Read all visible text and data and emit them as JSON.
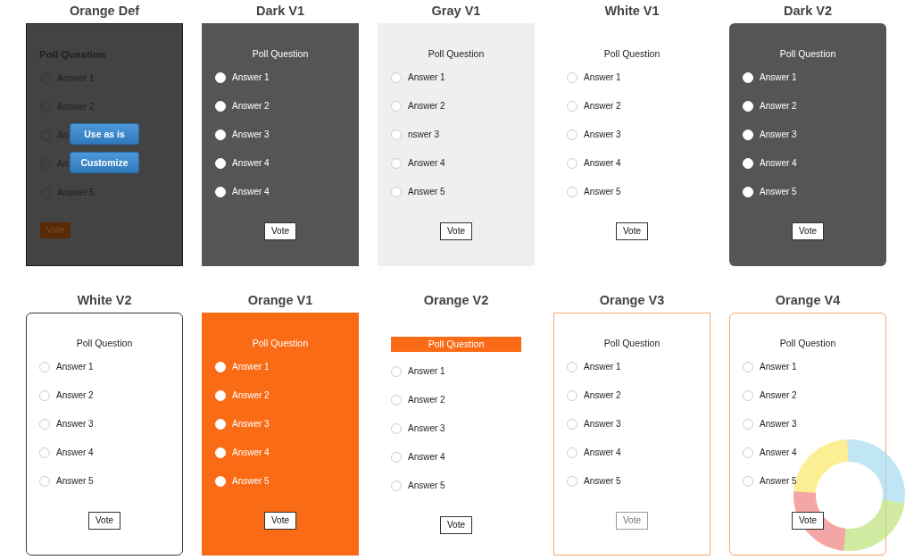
{
  "themes": [
    {
      "title": "Orange Def",
      "kind": "default",
      "hovered": true,
      "hover_actions": [
        "Use as is",
        "Customize"
      ],
      "poll": {
        "question": "Poll Question",
        "answers": [
          {
            "label": "Answer 1",
            "selected": false
          },
          {
            "label": "Answer 2",
            "selected": false
          },
          {
            "label": "An",
            "selected": false
          },
          {
            "label": "An",
            "selected": false
          },
          {
            "label": "Answer 5",
            "selected": false
          }
        ],
        "vote_button": "Vote"
      }
    },
    {
      "title": "Dark V1",
      "kind": "dark",
      "poll": {
        "question": "Poll Question",
        "answers": [
          {
            "label": "Answer 1",
            "selected": false
          },
          {
            "label": "Answer 2",
            "selected": false
          },
          {
            "label": "Answer 3",
            "selected": false
          },
          {
            "label": "Answer 4",
            "selected": false
          },
          {
            "label": "Answer 4",
            "selected": false
          }
        ],
        "vote_button": "Vote"
      }
    },
    {
      "title": "Gray V1",
      "kind": "gray",
      "poll": {
        "question": "Poll Question",
        "answers": [
          {
            "label": "Answer 1",
            "selected": false
          },
          {
            "label": "Answer 2",
            "selected": false
          },
          {
            "label": "nswer 3",
            "selected": false
          },
          {
            "label": "Answer 4",
            "selected": false
          },
          {
            "label": "Answer 5",
            "selected": false
          }
        ],
        "vote_button": "Vote"
      }
    },
    {
      "title": "White V1",
      "kind": "white",
      "poll": {
        "question": "Poll Question",
        "answers": [
          {
            "label": "Answer 1",
            "selected": false
          },
          {
            "label": "Answer 2",
            "selected": false
          },
          {
            "label": "Answer 3",
            "selected": false
          },
          {
            "label": "Answer 4",
            "selected": false
          },
          {
            "label": "Answer 5",
            "selected": false
          }
        ],
        "vote_button": "Vote"
      }
    },
    {
      "title": "Dark V2",
      "kind": "dark-rounded",
      "poll": {
        "question": "Poll Question",
        "answers": [
          {
            "label": "Answer 1",
            "selected": false
          },
          {
            "label": "Answer 2",
            "selected": false
          },
          {
            "label": "Answer 3",
            "selected": false
          },
          {
            "label": "Answer 4",
            "selected": false
          },
          {
            "label": "Answer 5",
            "selected": false
          }
        ],
        "vote_button": "Vote"
      }
    },
    {
      "title": "White V2",
      "kind": "bordered-rounded",
      "poll": {
        "question": "Poll Question",
        "answers": [
          {
            "label": "Answer 1",
            "selected": false
          },
          {
            "label": "Answer 2",
            "selected": false
          },
          {
            "label": "Answer 3",
            "selected": false
          },
          {
            "label": "Answer 4",
            "selected": false
          },
          {
            "label": "Answer 5",
            "selected": false
          }
        ],
        "vote_button": "Vote"
      }
    },
    {
      "title": "Orange V1",
      "kind": "orange",
      "poll": {
        "question": "Poll Question",
        "answers": [
          {
            "label": "Answer 1",
            "selected": false
          },
          {
            "label": "Answer 2",
            "selected": false
          },
          {
            "label": "Answer 3",
            "selected": false
          },
          {
            "label": "Answer 4",
            "selected": false
          },
          {
            "label": "Answer 5",
            "selected": false
          }
        ],
        "vote_button": "Vote"
      }
    },
    {
      "title": "Orange V2",
      "kind": "orange-banner",
      "poll": {
        "question": "Poll Question",
        "answers": [
          {
            "label": "Answer 1",
            "selected": false
          },
          {
            "label": "Answer 2",
            "selected": false
          },
          {
            "label": "Answer 3",
            "selected": false
          },
          {
            "label": "Answer 4",
            "selected": false
          },
          {
            "label": "Answer 5",
            "selected": false
          }
        ],
        "vote_button": "Vote"
      }
    },
    {
      "title": "Orange V3",
      "kind": "orange-outline",
      "poll": {
        "question": "Poll Question",
        "answers": [
          {
            "label": "Answer 1",
            "selected": false
          },
          {
            "label": "Answer 2",
            "selected": false
          },
          {
            "label": "Answer 3",
            "selected": false
          },
          {
            "label": "Answer 4",
            "selected": false
          },
          {
            "label": "Answer 5",
            "selected": false
          }
        ],
        "vote_button": "Vote"
      }
    },
    {
      "title": "Orange V4",
      "kind": "orange-outline-rounded",
      "poll": {
        "question": "Poll Question",
        "answers": [
          {
            "label": "Answer 1",
            "selected": false
          },
          {
            "label": "Answer 2",
            "selected": false
          },
          {
            "label": "Answer 3",
            "selected": false
          },
          {
            "label": "Answer 4",
            "selected": false
          },
          {
            "label": "Answer 5",
            "selected": false
          }
        ],
        "vote_button": "Vote"
      }
    }
  ]
}
